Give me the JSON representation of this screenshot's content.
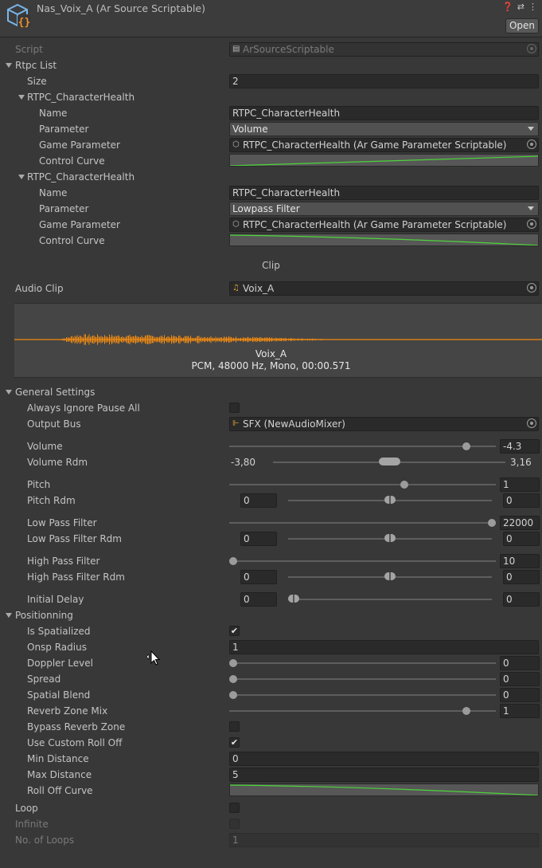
{
  "header": {
    "title": "Nas_Voix_A (Ar Source Scriptable)",
    "open_label": "Open",
    "icons": [
      "help-icon",
      "settings-icon",
      "more-icon",
      "scriptable-object-icon"
    ]
  },
  "script": {
    "label": "Script",
    "value": "ArSourceScriptable"
  },
  "rtpc": {
    "list_label": "Rtpc List",
    "size_label": "Size",
    "size_value": "2",
    "items": [
      {
        "header": "RTPC_CharacterHealth",
        "name_label": "Name",
        "name_value": "RTPC_CharacterHealth",
        "parameter_label": "Parameter",
        "parameter_value": "Volume",
        "game_parameter_label": "Game Parameter",
        "game_parameter_value": "RTPC_CharacterHealth (Ar Game Parameter Scriptable)",
        "curve_label": "Control Curve"
      },
      {
        "header": "RTPC_CharacterHealth",
        "name_label": "Name",
        "name_value": "RTPC_CharacterHealth",
        "parameter_label": "Parameter",
        "parameter_value": "Lowpass Filter",
        "game_parameter_label": "Game Parameter",
        "game_parameter_value": "RTPC_CharacterHealth (Ar Game Parameter Scriptable)",
        "curve_label": "Control Curve"
      }
    ]
  },
  "clip": {
    "section_label": "Clip",
    "audio_clip_label": "Audio Clip",
    "audio_clip_value": "Voix_A",
    "preview_name": "Voix_A",
    "preview_info": "PCM, 48000 Hz, Mono, 00:00.571"
  },
  "general": {
    "section_label": "General Settings",
    "always_ignore_pause_label": "Always Ignore Pause All",
    "always_ignore_pause_checked": false,
    "output_bus_label": "Output Bus",
    "output_bus_value": "SFX (NewAudioMixer)",
    "volume_label": "Volume",
    "volume_value": "-4.3",
    "volume_level": 0.9,
    "volume_rdm_label": "Volume Rdm",
    "volume_rdm_min": "-3,80",
    "volume_rdm_max": "3,16",
    "pitch_label": "Pitch",
    "pitch_value": "1",
    "pitch_level": 0.66,
    "pitch_rdm_label": "Pitch Rdm",
    "pitch_rdm_min": "0",
    "pitch_rdm_max": "0",
    "lpf_label": "Low Pass Filter",
    "lpf_value": "22000",
    "lpf_level": 1.0,
    "lpf_rdm_label": "Low Pass Filter Rdm",
    "lpf_rdm_min": "0",
    "lpf_rdm_max": "0",
    "hpf_label": "High Pass Filter",
    "hpf_value": "10",
    "hpf_level": 0.0,
    "hpf_rdm_label": "High Pass Filter Rdm",
    "hpf_rdm_min": "0",
    "hpf_rdm_max": "0",
    "initial_delay_label": "Initial Delay",
    "initial_delay_min": "0",
    "initial_delay_max": "0"
  },
  "positioning": {
    "section_label": "Positionning",
    "is_spatialized_label": "Is Spatialized",
    "is_spatialized_checked": true,
    "onsp_radius_label": "Onsp Radius",
    "onsp_radius_value": "1",
    "doppler_label": "Doppler Level",
    "doppler_value": "0",
    "doppler_level": 0.0,
    "spread_label": "Spread",
    "spread_value": "0",
    "spread_level": 0.0,
    "spatial_blend_label": "Spatial Blend",
    "spatial_blend_value": "0",
    "spatial_blend_level": 0.0,
    "reverb_mix_label": "Reverb Zone Mix",
    "reverb_mix_value": "1",
    "reverb_mix_level": 0.9,
    "bypass_reverb_label": "Bypass Reverb Zone",
    "bypass_reverb_checked": false,
    "custom_rolloff_label": "Use Custom Roll Off",
    "custom_rolloff_checked": true,
    "min_distance_label": "Min Distance",
    "min_distance_value": "0",
    "max_distance_label": "Max Distance",
    "max_distance_value": "5",
    "rolloff_curve_label": "Roll Off Curve"
  },
  "loop": {
    "loop_label": "Loop",
    "loop_checked": false,
    "infinite_label": "Infinite",
    "infinite_checked": false,
    "loops_label": "No. of Loops",
    "loops_value": "1"
  },
  "colors": {
    "curve": "#4cd43a",
    "waveform": "#f08a12",
    "background": "#383838"
  }
}
